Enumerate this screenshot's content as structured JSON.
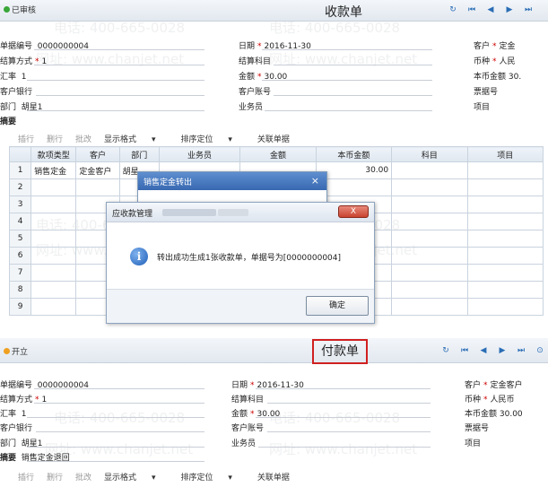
{
  "top_form": {
    "status": "已审核",
    "title": "收款单",
    "fields": {
      "doc_no_label": "单据编号",
      "doc_no": "0000000004",
      "date_label": "日期",
      "date": "2016-11-30",
      "customer_label": "客户",
      "customer": "定金",
      "settle_label": "结算方式",
      "settle": "1",
      "settle_account_label": "结算科目",
      "currency_label": "币种",
      "currency": "人民",
      "rate_label": "汇率",
      "rate": "1",
      "amount_label": "金额",
      "amount": "30.00",
      "local_amount_label": "本币金额",
      "local_amount": "30.",
      "bank_label": "客户银行",
      "account_label": "客户账号",
      "bill_no_label": "票据号",
      "dept_label": "部门",
      "dept": "胡星1",
      "staff_label": "业务员",
      "project_label": "项目",
      "summary_label": "摘要"
    },
    "toolbar": [
      "插行",
      "删行",
      "批改",
      "显示格式",
      "排序定位",
      "关联单据"
    ],
    "columns": [
      "款项类型",
      "客户",
      "部门",
      "业务员",
      "金额",
      "本币金额",
      "科目",
      "项目"
    ],
    "rows": [
      {
        "n": "1",
        "type": "销售定金",
        "customer": "定金客户",
        "dept": "胡星",
        "local": "30.00"
      },
      {
        "n": "2"
      },
      {
        "n": "3"
      },
      {
        "n": "4"
      },
      {
        "n": "5"
      },
      {
        "n": "6"
      },
      {
        "n": "7"
      },
      {
        "n": "8"
      },
      {
        "n": "9"
      }
    ]
  },
  "transfer_dialog": {
    "title": "销售定金转出",
    "close": "×"
  },
  "message_dialog": {
    "title": "应收款管理",
    "close": "X",
    "message": "转出成功生成1张收款单，单据号为[0000000004]",
    "ok": "确定"
  },
  "bottom_form": {
    "status": "开立",
    "title": "付款单",
    "fields": {
      "doc_no_label": "单据编号",
      "doc_no": "0000000004",
      "date_label": "日期",
      "date": "2016-11-30",
      "customer_label": "客户",
      "customer": "定金客户",
      "settle_label": "结算方式",
      "settle": "1",
      "settle_account_label": "结算科目",
      "currency_label": "币种",
      "currency": "人民币",
      "rate_label": "汇率",
      "rate": "1",
      "amount_label": "金额",
      "amount": "30.00",
      "local_amount_label": "本币金额",
      "local_amount": "30.00",
      "bank_label": "客户银行",
      "account_label": "客户账号",
      "bill_no_label": "票据号",
      "dept_label": "部门",
      "dept": "胡星1",
      "staff_label": "业务员",
      "project_label": "项目",
      "summary_label": "摘要",
      "summary": "销售定金退回"
    },
    "toolbar": [
      "插行",
      "删行",
      "批改",
      "显示格式",
      "排序定位",
      "关联单据"
    ]
  },
  "watermark": {
    "phone": "电话: 400-665-0028",
    "site": "网址: www.chanjet.net"
  },
  "colors": {
    "accent": "#2a6db5",
    "highlight": "#d02020",
    "required": "#c00000"
  }
}
